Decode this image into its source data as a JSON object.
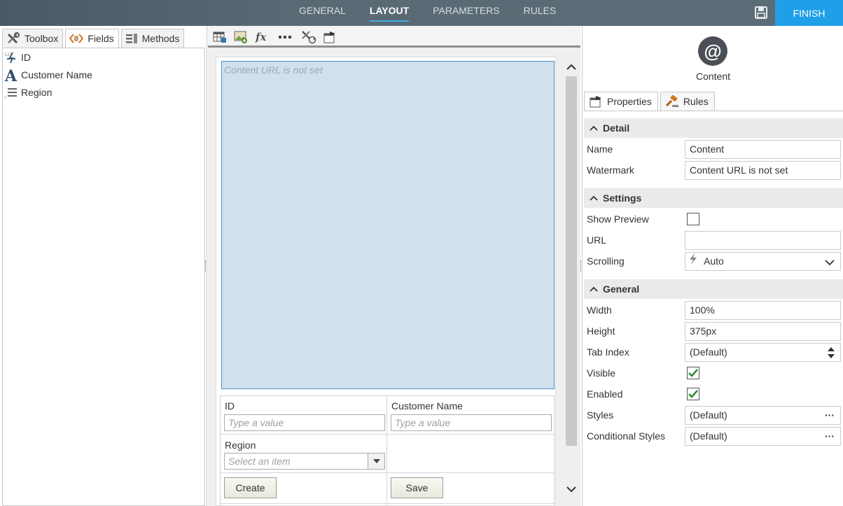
{
  "topnav": {
    "tabs": [
      {
        "label": "GENERAL",
        "active": false
      },
      {
        "label": "LAYOUT",
        "active": true
      },
      {
        "label": "PARAMETERS",
        "active": false
      },
      {
        "label": "RULES",
        "active": false
      }
    ],
    "save_icon": "floppy-disk-icon",
    "finish_label": "FINISH",
    "accent_color": "#1f9fe8"
  },
  "left_panel": {
    "tabs": [
      {
        "label": "Toolbox",
        "icon": "tools-icon"
      },
      {
        "label": "Fields",
        "icon": "fields-icon"
      },
      {
        "label": "Methods",
        "icon": "methods-icon"
      }
    ],
    "fields": [
      {
        "label": "ID",
        "icon": "autonumber-field-icon"
      },
      {
        "label": "Customer Name",
        "icon": "text-field-icon"
      },
      {
        "label": "Region",
        "icon": "list-field-icon"
      }
    ]
  },
  "canvas": {
    "toolbar_icons": [
      "table-icon",
      "image-add-icon",
      "expression-icon",
      "ellipsis-icon",
      "tools-refresh-icon",
      "properties-icon"
    ],
    "content_watermark": "Content URL is not set",
    "form": {
      "id_label": "ID",
      "id_placeholder": "Type a value",
      "customer_label": "Customer Name",
      "customer_placeholder": "Type a value",
      "region_label": "Region",
      "region_placeholder": "Select an item",
      "create_label": "Create",
      "save_label": "Save"
    }
  },
  "right_panel": {
    "control_icon_glyph": "@",
    "control_name": "Content",
    "tabs": [
      {
        "label": "Properties",
        "icon": "properties-icon"
      },
      {
        "label": "Rules",
        "icon": "gavel-icon"
      }
    ],
    "sections": {
      "detail": "Detail",
      "settings": "Settings",
      "general": "General"
    },
    "props": {
      "name_label": "Name",
      "name_value": "Content",
      "watermark_label": "Watermark",
      "watermark_value": "Content URL is not set",
      "show_preview_label": "Show Preview",
      "show_preview_checked": false,
      "url_label": "URL",
      "url_value": "",
      "scrolling_label": "Scrolling",
      "scrolling_value": "Auto",
      "width_label": "Width",
      "width_value": "100%",
      "height_label": "Height",
      "height_value": "375px",
      "tab_index_label": "Tab Index",
      "tab_index_value": "(Default)",
      "visible_label": "Visible",
      "visible_checked": true,
      "enabled_label": "Enabled",
      "enabled_checked": true,
      "styles_label": "Styles",
      "styles_value": "(Default)",
      "cond_styles_label": "Conditional Styles",
      "cond_styles_value": "(Default)",
      "ellipsis": "···"
    }
  }
}
